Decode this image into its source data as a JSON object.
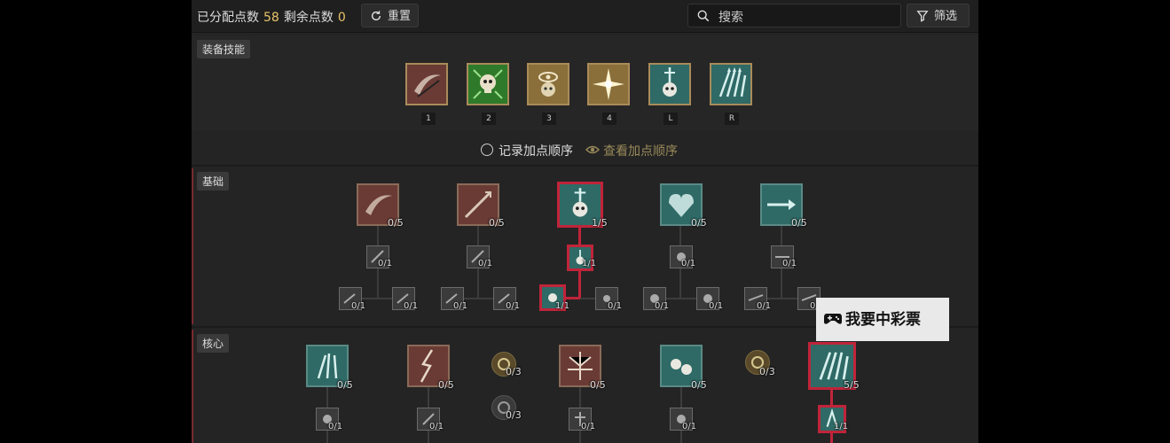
{
  "header": {
    "allocated_label": "已分配点数",
    "allocated_value": "58",
    "remaining_label": "剩余点数",
    "remaining_value": "0",
    "reset_label": "重置",
    "search_placeholder": "搜索",
    "filter_label": "筛选"
  },
  "equipped": {
    "title": "装备技能",
    "slots": [
      {
        "key": "1",
        "icon": "scythe-slash-icon",
        "color": "#6a3b35"
      },
      {
        "key": "2",
        "icon": "skull-poison-icon",
        "color": "#2f7a2a"
      },
      {
        "key": "3",
        "icon": "eye-skull-icon",
        "color": "#8a6f3a"
      },
      {
        "key": "4",
        "icon": "star-burst-icon",
        "color": "#8a6f3a"
      },
      {
        "key": "L",
        "icon": "skull-sword-icon",
        "color": "#2f6a66"
      },
      {
        "key": "R",
        "icon": "bone-spear-icon",
        "color": "#2f6a66"
      }
    ],
    "record_order_label": "记录加点顺序",
    "view_order_label": "查看加点顺序"
  },
  "basic": {
    "title": "基础",
    "main": [
      "0/5",
      "0/5",
      "1/5",
      "0/5",
      "0/5"
    ],
    "upgrades": [
      "0/1",
      "0/1",
      "1/1",
      "0/1",
      "0/1"
    ],
    "modifiers": [
      "0/1",
      "0/1",
      "0/1",
      "0/1",
      "1/1",
      "0/1",
      "0/1",
      "0/1",
      "0/1",
      "0/1"
    ]
  },
  "core": {
    "title": "核心",
    "main": [
      "0/5",
      "0/5",
      "0/3",
      "0/5",
      "0/5",
      "0/3",
      "5/5"
    ],
    "extra": "0/3",
    "upgrades": [
      "0/1",
      "0/1",
      "0/1",
      "0/1",
      "1/1"
    ]
  },
  "watermark": "我要中彩票",
  "colors": {
    "points": "#e8c46a",
    "selected": "#c0243a",
    "teal": "#2f6a66",
    "rust": "#6a3b35"
  }
}
